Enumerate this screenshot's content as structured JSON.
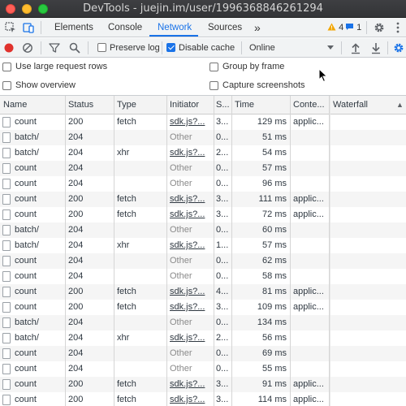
{
  "window": {
    "title": "DevTools - juejin.im/user/1996368846261294"
  },
  "main_tabs": {
    "elements": "Elements",
    "console": "Console",
    "network": "Network",
    "sources": "Sources",
    "more": "»",
    "warnings_count": "4",
    "messages_count": "1"
  },
  "toolbar": {
    "preserve_log": {
      "label": "Preserve log",
      "checked": false
    },
    "disable_cache": {
      "label": "Disable cache",
      "checked": true
    },
    "throttle": "Online"
  },
  "settings": {
    "large_rows": {
      "label": "Use large request rows",
      "checked": false
    },
    "group_by_frame": {
      "label": "Group by frame",
      "checked": false
    },
    "show_overview": {
      "label": "Show overview",
      "checked": false
    },
    "capture_screenshots": {
      "label": "Capture screenshots",
      "checked": false
    }
  },
  "grid": {
    "columns": [
      "Name",
      "Status",
      "Type",
      "Initiator",
      "S...",
      "Time",
      "Conte...",
      "Waterfall"
    ],
    "sort_indicator": "▲",
    "rows": [
      [
        "count",
        "200",
        "fetch",
        "sdk.js?...",
        "3...",
        "129 ms",
        "applic..."
      ],
      [
        "batch/",
        "204",
        "",
        "Other",
        "0...",
        "51 ms",
        ""
      ],
      [
        "batch/",
        "204",
        "xhr",
        "sdk.js?...",
        "2...",
        "54 ms",
        ""
      ],
      [
        "count",
        "204",
        "",
        "Other",
        "0...",
        "57 ms",
        ""
      ],
      [
        "count",
        "204",
        "",
        "Other",
        "0...",
        "96 ms",
        ""
      ],
      [
        "count",
        "200",
        "fetch",
        "sdk.js?...",
        "3...",
        "111 ms",
        "applic..."
      ],
      [
        "count",
        "200",
        "fetch",
        "sdk.js?...",
        "3...",
        "72 ms",
        "applic..."
      ],
      [
        "batch/",
        "204",
        "",
        "Other",
        "0...",
        "60 ms",
        ""
      ],
      [
        "batch/",
        "204",
        "xhr",
        "sdk.js?...",
        "1...",
        "57 ms",
        ""
      ],
      [
        "count",
        "204",
        "",
        "Other",
        "0...",
        "62 ms",
        ""
      ],
      [
        "count",
        "204",
        "",
        "Other",
        "0...",
        "58 ms",
        ""
      ],
      [
        "count",
        "200",
        "fetch",
        "sdk.js?...",
        "4...",
        "81 ms",
        "applic..."
      ],
      [
        "count",
        "200",
        "fetch",
        "sdk.js?...",
        "3...",
        "109 ms",
        "applic..."
      ],
      [
        "batch/",
        "204",
        "",
        "Other",
        "0...",
        "134 ms",
        ""
      ],
      [
        "batch/",
        "204",
        "xhr",
        "sdk.js?...",
        "2...",
        "56 ms",
        ""
      ],
      [
        "count",
        "204",
        "",
        "Other",
        "0...",
        "69 ms",
        ""
      ],
      [
        "count",
        "204",
        "",
        "Other",
        "0...",
        "55 ms",
        ""
      ],
      [
        "count",
        "200",
        "fetch",
        "sdk.js?...",
        "3...",
        "91 ms",
        "applic..."
      ],
      [
        "count",
        "200",
        "fetch",
        "sdk.js?...",
        "3...",
        "114 ms",
        "applic..."
      ]
    ]
  },
  "colors": {
    "accent": "#1a73e8",
    "record": "#e0322d",
    "warning": "#f2a600",
    "titlebar": "#3a3b3e"
  }
}
